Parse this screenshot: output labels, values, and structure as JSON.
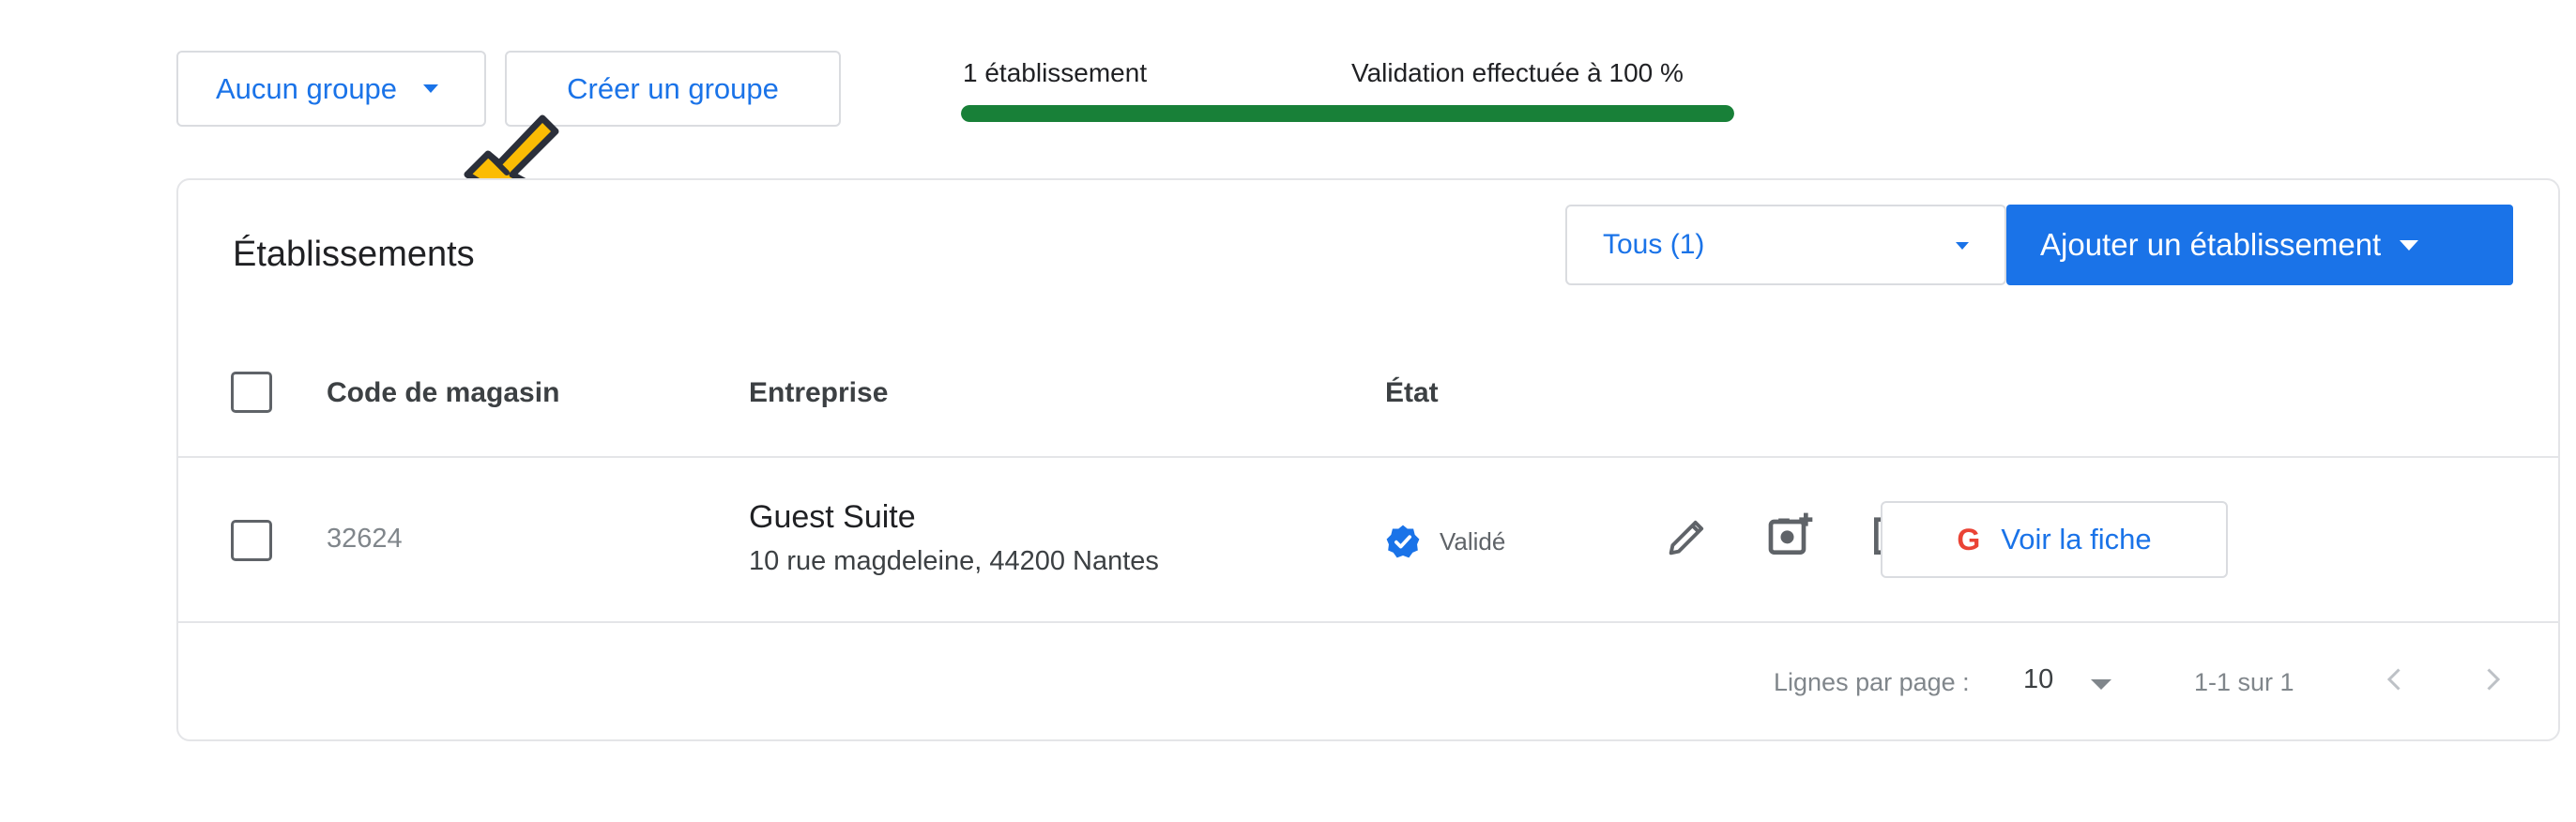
{
  "toolbar": {
    "group_select_label": "Aucun groupe",
    "create_group_label": "Créer un groupe",
    "count_label": "1 établissement",
    "validation_label": "Validation effectuée à 100 %",
    "validation_progress": 1.0
  },
  "card": {
    "title": "Établissements",
    "filter_label": "Tous (1)",
    "add_button_label": "Ajouter un établissement"
  },
  "table": {
    "headers": {
      "store_code": "Code de magasin",
      "business": "Entreprise",
      "state": "État"
    },
    "rows": [
      {
        "store_code": "32624",
        "business_name": "Guest Suite",
        "business_address": "10 rue magdeleine, 44200 Nantes",
        "state": "Validé",
        "view_label": "Voir la fiche",
        "google_letter": "G"
      }
    ]
  },
  "footer": {
    "rows_per_page_label": "Lignes par page :",
    "rows_per_page_value": "10",
    "range_label": "1-1 sur 1"
  },
  "colors": {
    "accent": "#1a73e8",
    "progress": "#188038",
    "verified": "#1a73e8",
    "cursor": "#fbbc04"
  },
  "icons": {
    "cursor": "hand-cursor-icon",
    "verified": "verified-check-icon",
    "edit": "pencil-icon",
    "add_photo": "add-photo-icon",
    "add_post": "add-post-icon",
    "prev": "chevron-left-icon",
    "next": "chevron-right-icon"
  }
}
